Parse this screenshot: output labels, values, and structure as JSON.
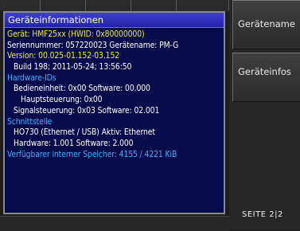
{
  "panel": {
    "title": "Geräteinformationen",
    "lines": [
      "Gerät: HMF25xx (HWID: 0x80000000)",
      "Seriennummer: 057220023 Gerätename: PM-G",
      "Version: 00.025-01.152-03.152",
      "Build 198; 2011-05-24; 13:56:50",
      "Hardware-IDs",
      "Bedieneinheit: 0x00  Software: 00.000",
      "Hauptsteuerung: 0x00",
      "Signalsteuerung: 0x03  Software: 02.001",
      "Schnittstelle",
      "HO730 (Ethernet / USB) Aktiv: Ethernet",
      "Hardware: 1.001 Software: 2.000",
      "Verfügbarer interner Speicher: 4155 / 4221 KiB"
    ]
  },
  "softkeys": {
    "geraetename": "Gerätename",
    "geraeteinfos": "Geräteinfos"
  },
  "page_indicator": "SEITE 2|2",
  "colors": {
    "panel_bg": "#050a4a",
    "title_bar": "#2f2fc0",
    "highlight_yellow": "#f2ee2e",
    "heading_blue": "#35b4ff",
    "text_white": "#ffffff"
  }
}
